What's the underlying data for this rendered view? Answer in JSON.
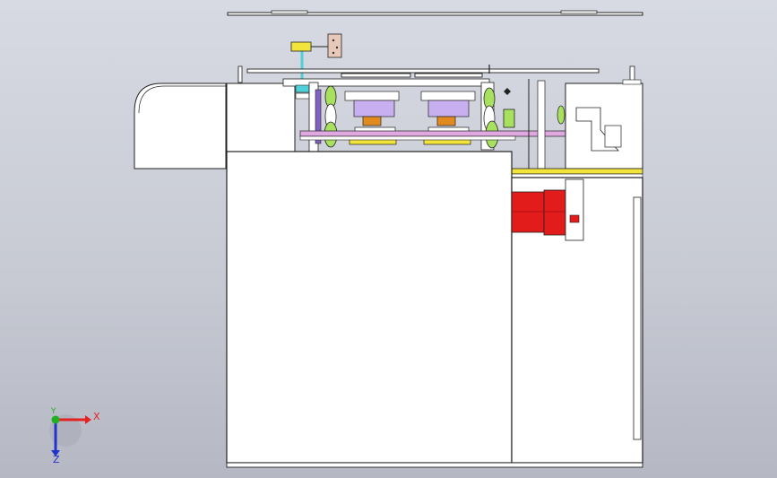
{
  "viewport": {
    "background_top": "#d7dae2",
    "background_bottom": "#b5b8c3"
  },
  "triad": {
    "x_label": "X",
    "y_label": "Y",
    "z_label": "Z",
    "x_color": "#e52222",
    "y_color": "#22b022",
    "z_color": "#2233cc"
  },
  "colors": {
    "line": "#222222",
    "body_fill": "#ffffff",
    "motor_red": "#e21b1b",
    "accent_yellow": "#f2e43a",
    "gear_green": "#a8e060",
    "cyan_part": "#4fd0d8",
    "purple_part": "#b08be0",
    "pink_part": "#e0a8e0",
    "tan_part": "#e8c8a0",
    "orange_part": "#e08a20"
  }
}
